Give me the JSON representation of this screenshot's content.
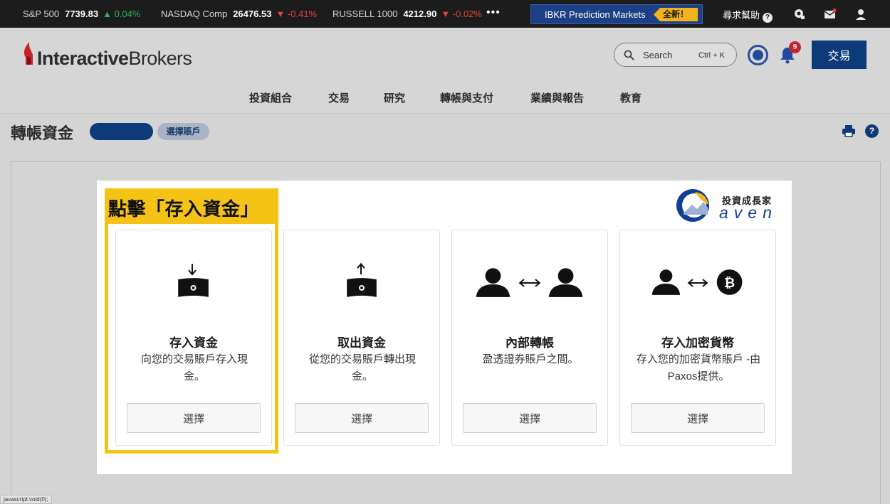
{
  "ticker": [
    {
      "name": "S&P 500",
      "value": "7739.83",
      "change": "▲ 0.04%",
      "dir": "up"
    },
    {
      "name": "NASDAQ Comp",
      "value": "26476.53",
      "change": "▼ -0.41%",
      "dir": "down"
    },
    {
      "name": "RUSSELL 1000",
      "value": "4212.90",
      "change": "▼ -0.02%",
      "dir": "down"
    }
  ],
  "ticker_more": "•••",
  "promo": {
    "label": "IBKR Prediction Markets",
    "badge": "全新！"
  },
  "topbar": {
    "help_label": "尋求幫助",
    "help_q": "?"
  },
  "logo": {
    "text_bold": "Interactive",
    "text_rest": "Brokers"
  },
  "search": {
    "label": "Search",
    "shortcut": "Ctrl + K"
  },
  "notifications": {
    "count": "9"
  },
  "trade_button": "交易",
  "nav": [
    "投資組合",
    "交易",
    "研究",
    "轉帳與支付",
    "業績與報告",
    "教育"
  ],
  "page": {
    "title": "轉帳資金",
    "account_selector": "選擇賬戶",
    "help_q": "?"
  },
  "highlight_caption": "點擊「存入資金」",
  "brand": {
    "title": "投資成長家",
    "name": "aven"
  },
  "cards": [
    {
      "title": "存入資金",
      "desc": "向您的交易賬戶存入現金。",
      "button": "選擇",
      "icon": "deposit-money-icon"
    },
    {
      "title": "取出資金",
      "desc": "從您的交易賬戶轉出現金。",
      "button": "選擇",
      "icon": "withdraw-money-icon"
    },
    {
      "title": "內部轉帳",
      "desc": "盈透證券賬戶之間。",
      "button": "選擇",
      "icon": "internal-transfer-icon"
    },
    {
      "title": "存入加密貨幣",
      "desc": "存入您的加密貨幣賬戶 -由Paxos提供。",
      "button": "選擇",
      "icon": "crypto-deposit-icon"
    }
  ],
  "status_bar": "javascript:void(0);",
  "colors": {
    "highlight": "#f5c315",
    "primary": "#0d3b7a",
    "up": "#2fb45a",
    "down": "#e0423f"
  }
}
